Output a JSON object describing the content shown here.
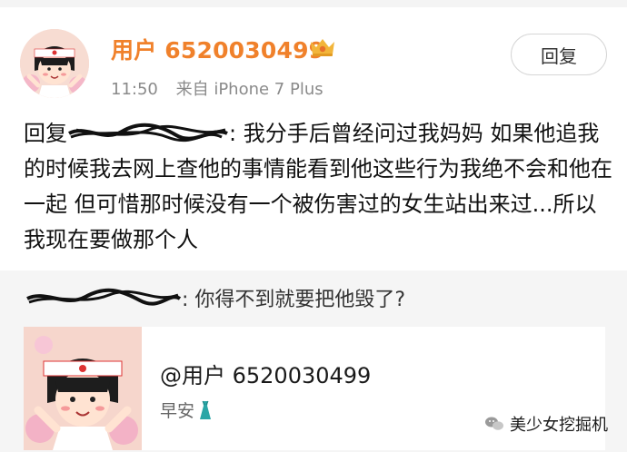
{
  "post": {
    "username": "用户 6520030499",
    "time": "11:50",
    "source": "来自 iPhone 7 Plus",
    "reply_button": "回复",
    "reply_prefix": "回复",
    "reply_suffix": ": 我分手后曾经问过我妈妈 如果他追我的时候我去网上查他的事情能看到他这些行为我绝不会和他在一起 但可惜那时候没有一个被伤害过的女生站出来过...所以我现在要做那个人"
  },
  "quoted": {
    "text": ": 你得不到就要把他毁了?",
    "card_user": "@用户 6520030499",
    "card_sub": "早安"
  },
  "watermark": {
    "text": "美少女挖掘机",
    "icon": "wechat-icon"
  },
  "colors": {
    "username": "#f0812b",
    "crown": "#f2b53a",
    "dress": "#2aa6a6"
  }
}
